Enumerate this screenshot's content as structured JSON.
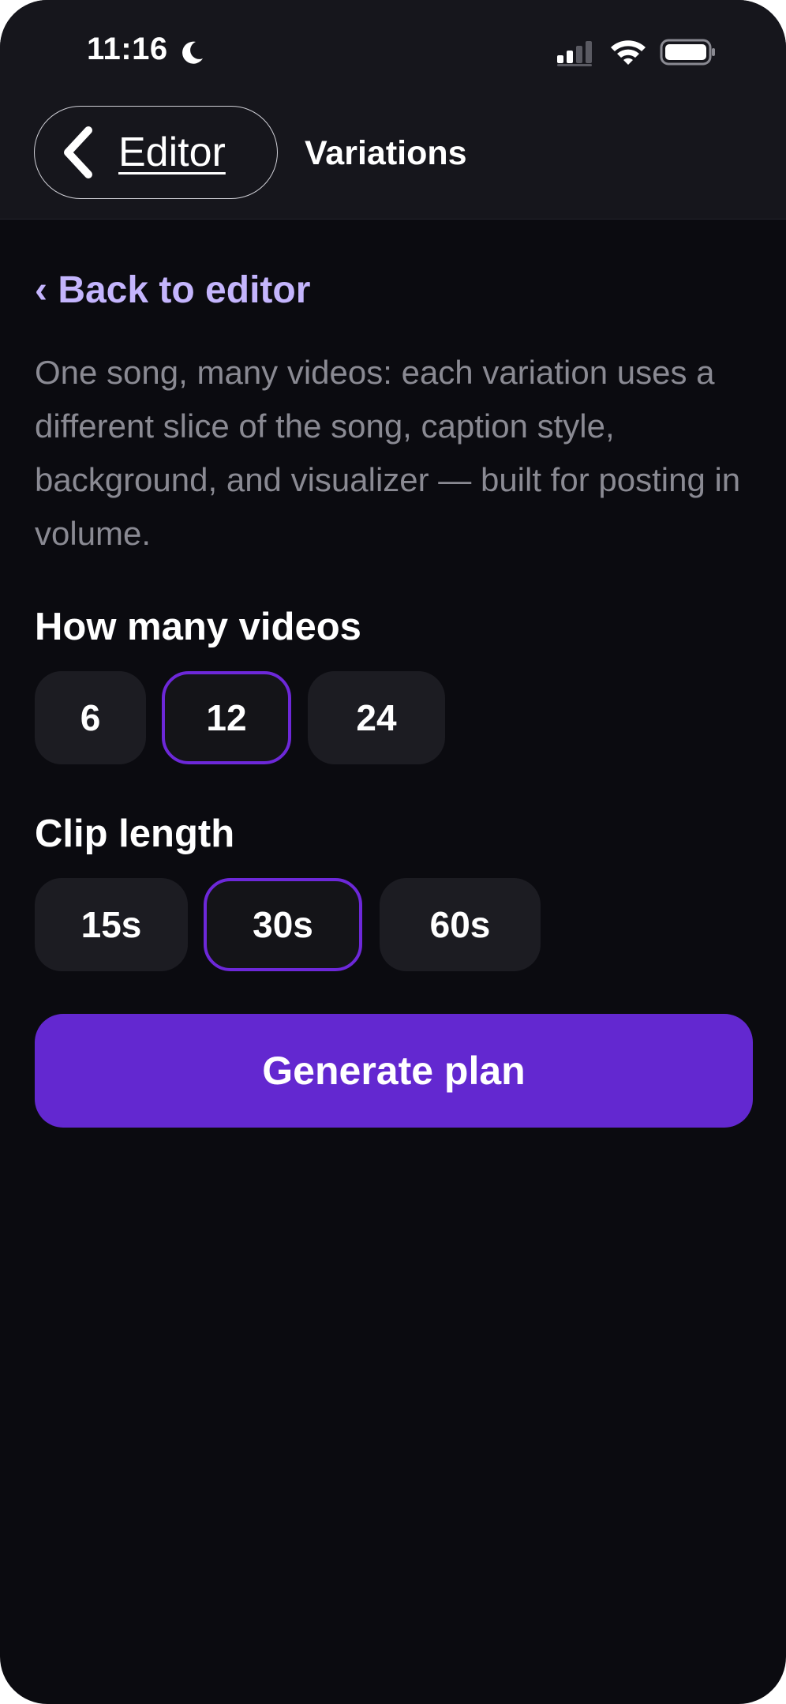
{
  "status_bar": {
    "time": "11:16"
  },
  "nav": {
    "back_label": "Editor",
    "title": "Variations"
  },
  "content": {
    "back_link": "‹ Back to editor",
    "description": "One song, many videos: each variation uses a different slice of the song, caption style, background, and visualizer — built for posting in volume."
  },
  "video_count": {
    "title": "How many videos",
    "options": [
      "6",
      "12",
      "24"
    ],
    "selected": "12"
  },
  "clip_length": {
    "title": "Clip length",
    "options": [
      "15s",
      "30s",
      "60s"
    ],
    "selected": "30s"
  },
  "generate_button": {
    "label": "Generate plan"
  },
  "colors": {
    "background": "#0b0b10",
    "header": "#16161c",
    "accent": "#6328d0",
    "accent_border": "#6d28d9",
    "link": "#c4b5fd",
    "muted_text": "#8a8a93",
    "chip": "#1c1c22"
  }
}
